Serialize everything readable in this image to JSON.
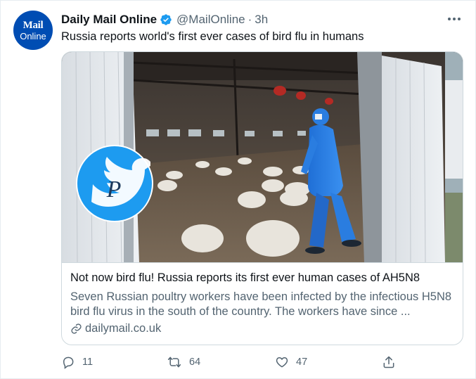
{
  "account": {
    "avatar_line1": "Mail",
    "avatar_line2": "Online",
    "name": "Daily Mail Online",
    "handle": "@MailOnline",
    "separator": "·",
    "time": "3h"
  },
  "tweet": {
    "text": "Russia reports world's first ever cases of bird flu in humans"
  },
  "card": {
    "title": "Not now bird flu! Russia reports its first ever human cases of AH5N8",
    "description": "Seven Russian poultry workers have been infected by the infectious H5N8 bird flu virus in the south of the country. The workers have since ...",
    "link": "dailymail.co.uk"
  },
  "actions": {
    "replies": "11",
    "retweets": "64",
    "likes": "47"
  },
  "colors": {
    "accent": "#1d9bf0",
    "text_secondary": "#536471",
    "avatar_bg": "#004db3",
    "retweet_green": "#17bf63"
  },
  "icons": [
    "verified-badge-icon",
    "more-icon",
    "link-icon",
    "reply-icon",
    "retweet-icon",
    "like-icon",
    "share-icon",
    "twitter-bird-icon"
  ]
}
